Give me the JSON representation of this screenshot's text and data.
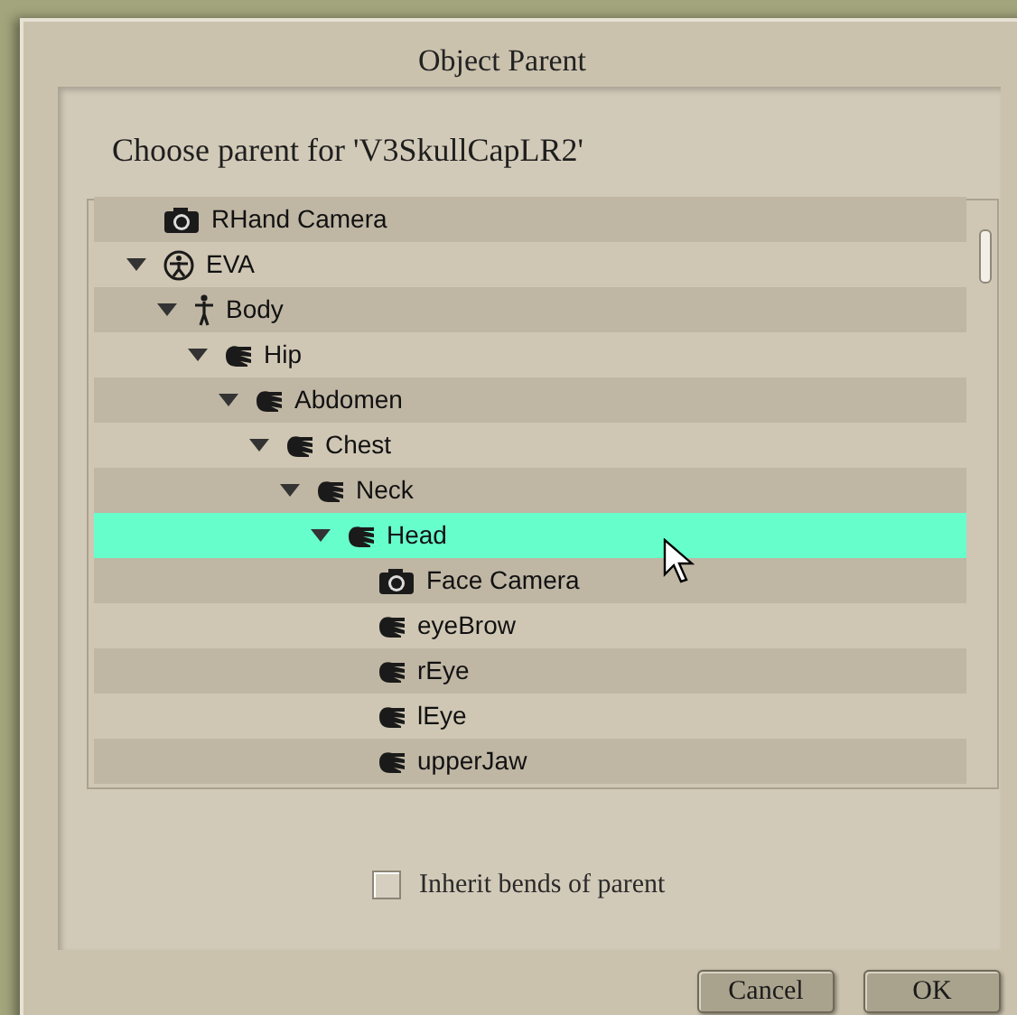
{
  "window": {
    "title": "Object Parent"
  },
  "prompt": "Choose parent for 'V3SkullCapLR2'",
  "tree": [
    {
      "label": "RHand Camera",
      "kind": "camera",
      "selected": false
    },
    {
      "label": "EVA",
      "kind": "figure",
      "expanded": true,
      "selected": false,
      "children": [
        {
          "label": "Body",
          "kind": "body",
          "expanded": true,
          "selected": false,
          "children": [
            {
              "label": "Hip",
              "kind": "bone",
              "expanded": true,
              "selected": false,
              "children": [
                {
                  "label": "Abdomen",
                  "kind": "bone",
                  "expanded": true,
                  "selected": false,
                  "children": [
                    {
                      "label": "Chest",
                      "kind": "bone",
                      "expanded": true,
                      "selected": false,
                      "children": [
                        {
                          "label": "Neck",
                          "kind": "bone",
                          "expanded": true,
                          "selected": false,
                          "children": [
                            {
                              "label": "Head",
                              "kind": "bone",
                              "expanded": true,
                              "selected": true,
                              "children": [
                                {
                                  "label": "Face Camera",
                                  "kind": "camera",
                                  "selected": false
                                },
                                {
                                  "label": "eyeBrow",
                                  "kind": "bone",
                                  "selected": false
                                },
                                {
                                  "label": "rEye",
                                  "kind": "bone",
                                  "selected": false
                                },
                                {
                                  "label": "lEye",
                                  "kind": "bone",
                                  "selected": false
                                },
                                {
                                  "label": "upperJaw",
                                  "kind": "bone",
                                  "selected": false
                                }
                              ]
                            }
                          ]
                        }
                      ]
                    }
                  ]
                }
              ]
            }
          ]
        }
      ]
    }
  ],
  "inherit_bends": {
    "label": "Inherit bends of parent",
    "checked": false
  },
  "buttons": [
    "Cancel",
    "OK"
  ]
}
